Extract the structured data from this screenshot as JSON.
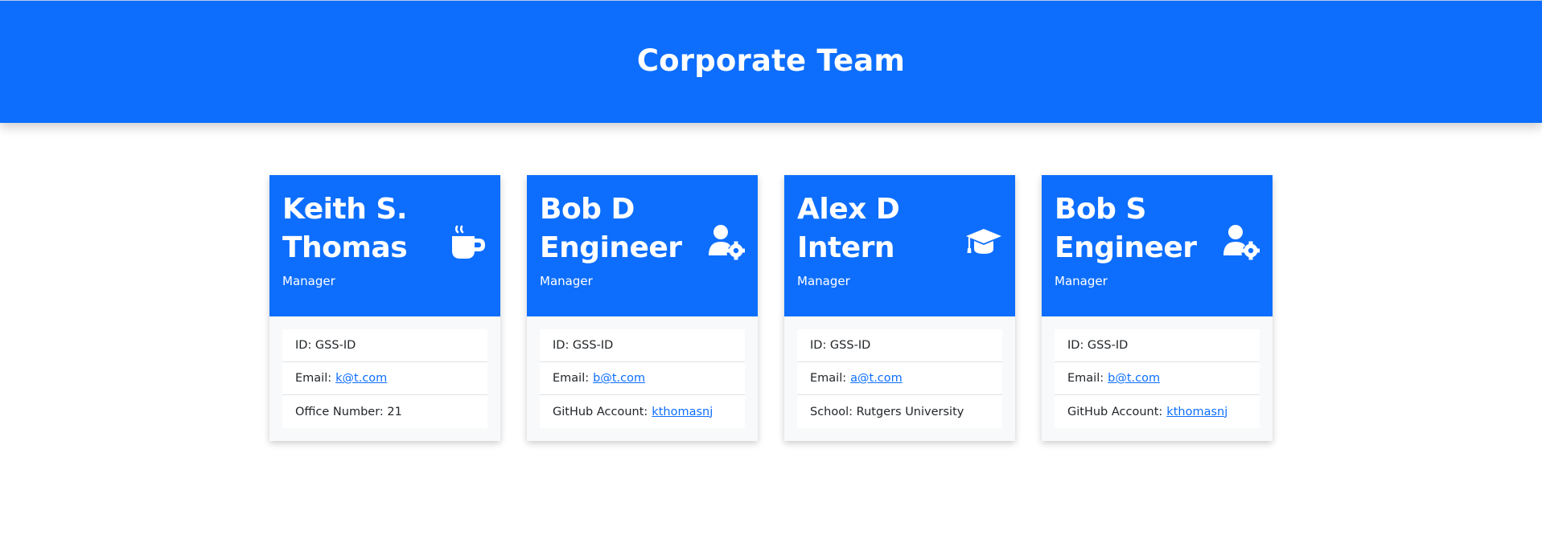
{
  "header": {
    "title": "Corporate Team"
  },
  "cards": [
    {
      "name": "Keith S. Thomas",
      "role": "Manager",
      "icon": "mug-icon",
      "id_text": "ID: GSS-ID",
      "email_label": "Email:",
      "email": "k@t.com",
      "extra_label": "Office Number:",
      "extra_value": "21"
    },
    {
      "name": "Bob D Engineer",
      "role": "Manager",
      "icon": "user-gear-icon",
      "id_text": "ID: GSS-ID",
      "email_label": "Email:",
      "email": "b@t.com",
      "extra_label": "GitHub Account:",
      "extra_value": "kthomasnj"
    },
    {
      "name": "Alex D Intern",
      "role": "Manager",
      "icon": "graduation-cap-icon",
      "id_text": "ID: GSS-ID",
      "email_label": "Email:",
      "email": "a@t.com",
      "extra_label": "School:",
      "extra_value": "Rutgers University"
    },
    {
      "name": "Bob S Engineer",
      "role": "Manager",
      "icon": "user-gear-icon",
      "id_text": "ID: GSS-ID",
      "email_label": "Email:",
      "email": "b@t.com",
      "extra_label": "GitHub Account:",
      "extra_value": "kthomasnj"
    }
  ],
  "colors": {
    "primary": "#0d6efd",
    "card_body": "#f8f9fa",
    "text": "#212529"
  }
}
